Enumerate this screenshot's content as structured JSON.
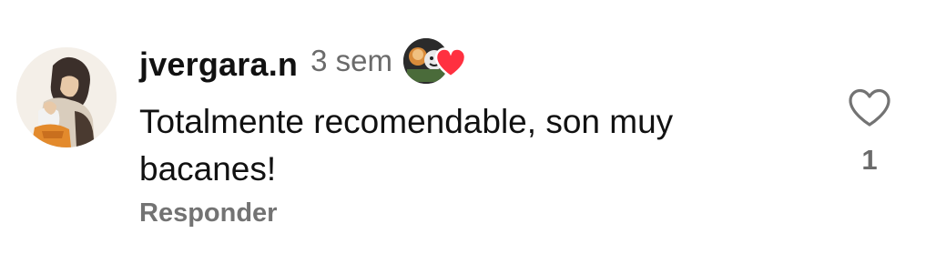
{
  "comment": {
    "username": "jvergara.n",
    "time": "3 sem",
    "text": "Totalmente recomendable, son muy bacanes!",
    "reply_label": "Responder",
    "like_count": "1",
    "liked_by_author": true,
    "icons": {
      "like": "heart-outline-icon",
      "liked_badge": "heart-filled-icon"
    },
    "colors": {
      "heart_red": "#ff3040",
      "secondary_text": "#737373"
    }
  }
}
